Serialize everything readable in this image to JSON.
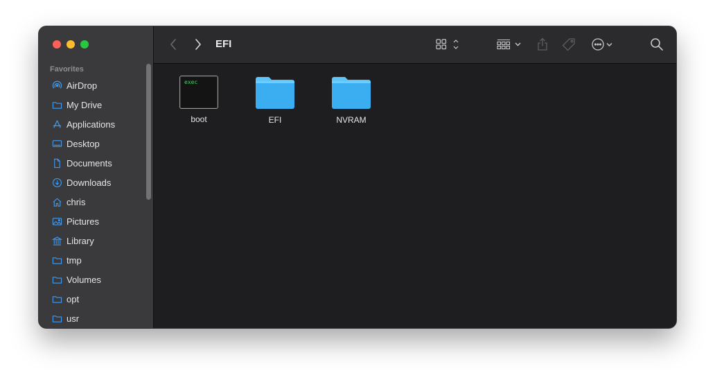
{
  "window": {
    "title": "EFI",
    "colors": {
      "sidebar": "#3a3a3c",
      "content": "#1e1e20",
      "folder": "#3aaef0",
      "accent": "#3e9bf3"
    }
  },
  "sidebar": {
    "section_label": "Favorites",
    "items": [
      {
        "label": "AirDrop",
        "icon": "airdrop-icon"
      },
      {
        "label": "My Drive",
        "icon": "folder-icon"
      },
      {
        "label": "Applications",
        "icon": "applications-icon"
      },
      {
        "label": "Desktop",
        "icon": "desktop-icon"
      },
      {
        "label": "Documents",
        "icon": "document-icon"
      },
      {
        "label": "Downloads",
        "icon": "downloads-icon"
      },
      {
        "label": "chris",
        "icon": "home-icon"
      },
      {
        "label": "Pictures",
        "icon": "pictures-icon"
      },
      {
        "label": "Library",
        "icon": "library-icon"
      },
      {
        "label": "tmp",
        "icon": "folder-icon"
      },
      {
        "label": "Volumes",
        "icon": "folder-icon"
      },
      {
        "label": "opt",
        "icon": "folder-icon"
      },
      {
        "label": "usr",
        "icon": "folder-icon"
      }
    ]
  },
  "toolbar": {
    "back": "chevron-left-icon",
    "forward": "chevron-right-icon",
    "view_mode": "icon-grid-icon",
    "group": "group-icon",
    "share": "share-icon",
    "tag": "tag-icon",
    "more": "ellipsis-circle-icon",
    "search": "search-icon"
  },
  "files": [
    {
      "name": "boot",
      "kind": "executable",
      "badge": "exec"
    },
    {
      "name": "EFI",
      "kind": "folder"
    },
    {
      "name": "NVRAM",
      "kind": "folder"
    }
  ]
}
